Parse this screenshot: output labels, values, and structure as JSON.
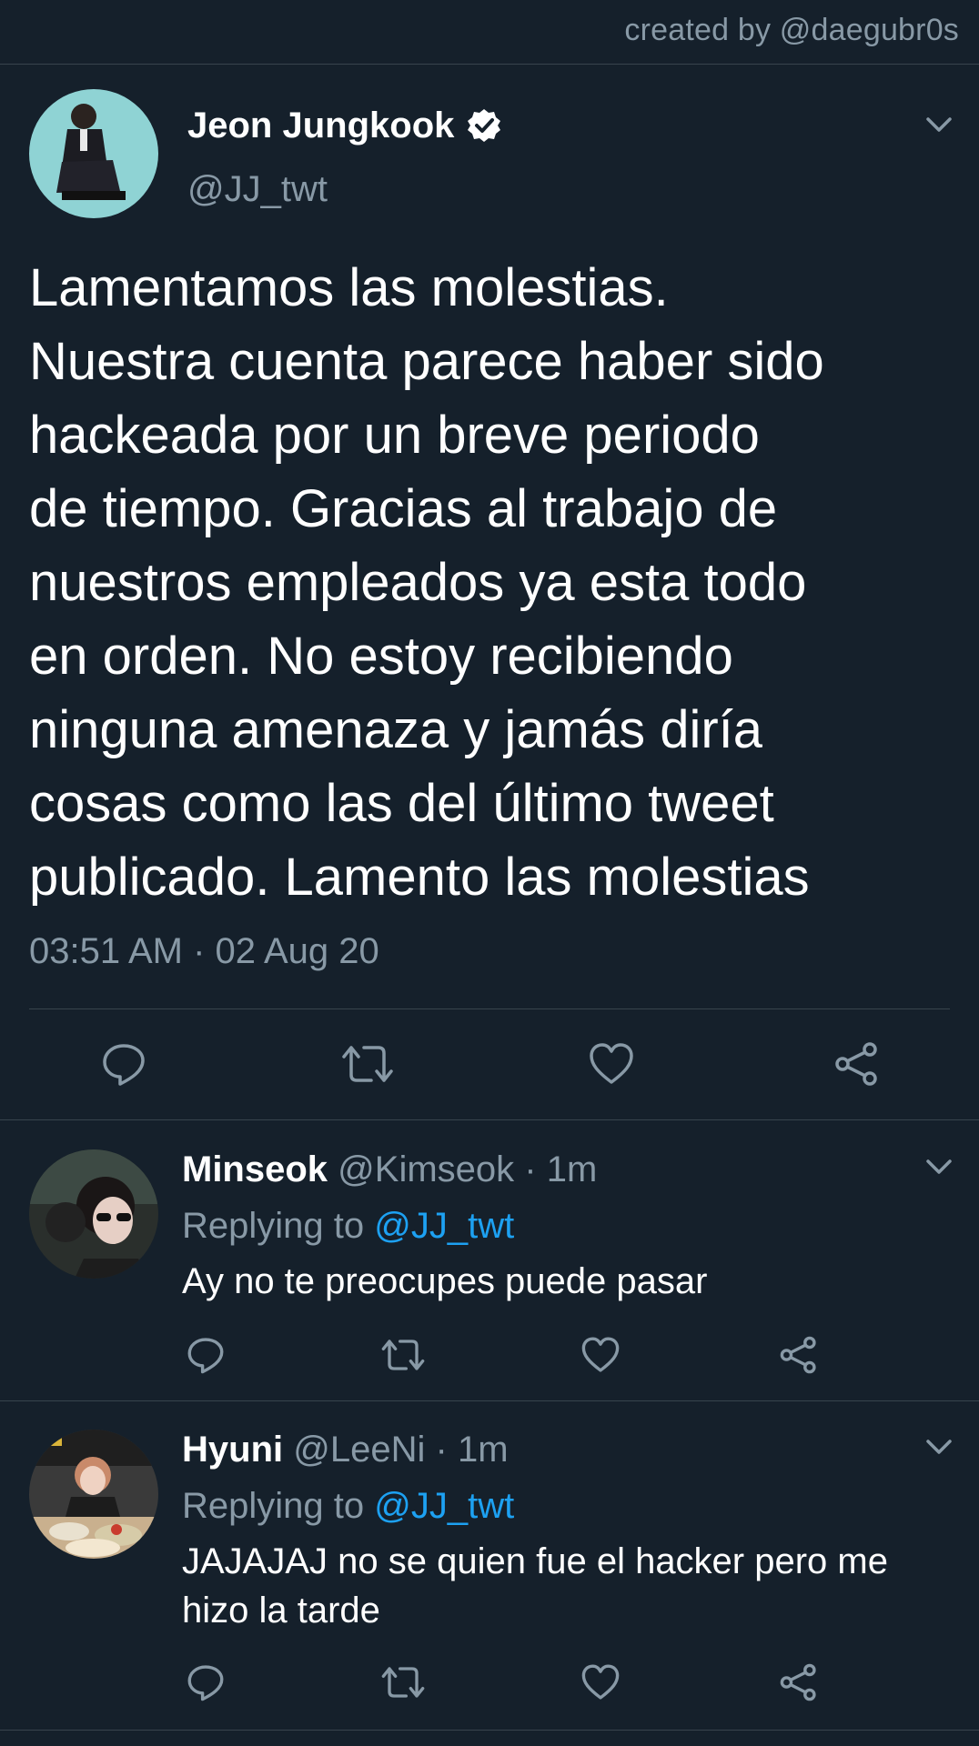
{
  "credit": "created by @daegubr0s",
  "main_tweet": {
    "author_name": "Jeon Jungkook",
    "author_handle": "@JJ_twt",
    "verified": true,
    "text": "Lamentamos las molestias.\nNuestra cuenta parece haber sido\nhackeada por un breve periodo\nde tiempo. Gracias al trabajo de\nnuestros empleados ya esta todo\nen orden. No estoy recibiendo\nninguna amenaza y jamás diría\ncosas como las del último tweet\npublicado. Lamento las molestias",
    "time": "03:51 AM · 02 Aug 20",
    "icons": [
      "reply-icon",
      "retweet-icon",
      "like-icon",
      "share-icon"
    ]
  },
  "replies": [
    {
      "name": "Minseok",
      "handle": "@Kimseok",
      "age": "1m",
      "replying_label": "Replying to",
      "replying_to": "@JJ_twt",
      "text": "Ay no te preocupes puede pasar"
    },
    {
      "name": "Hyuni",
      "handle": "@LeeNi",
      "age": "1m",
      "replying_label": "Replying to",
      "replying_to": "@JJ_twt",
      "text": "JAJAJAJ no se quien fue el hacker pero me hizo la tarde"
    }
  ],
  "colors": {
    "background": "#15202b",
    "text": "#ffffff",
    "secondary": "#8899a6",
    "accent": "#1da1f2",
    "divider": "#38444d"
  }
}
